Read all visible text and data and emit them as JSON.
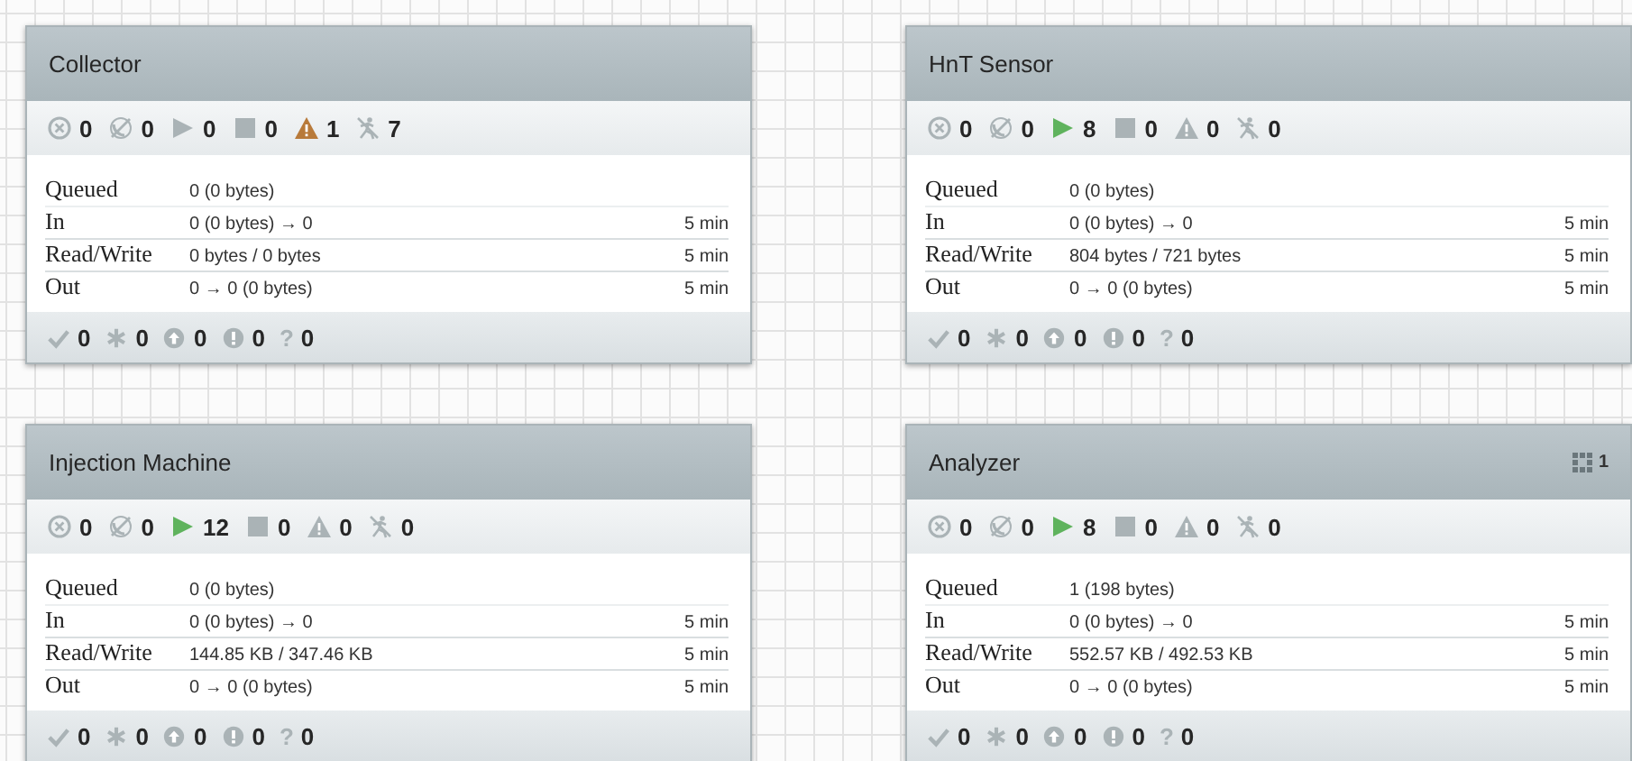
{
  "process_groups": [
    {
      "name": "Collector",
      "status": [
        {
          "kind": "transmitting",
          "count": "0",
          "highlighted": false
        },
        {
          "kind": "not_transmitting",
          "count": "0",
          "highlighted": false
        },
        {
          "kind": "running",
          "count": "0",
          "highlighted": false
        },
        {
          "kind": "stopped",
          "count": "0",
          "highlighted": false
        },
        {
          "kind": "invalid",
          "count": "1",
          "highlighted": true
        },
        {
          "kind": "disabled",
          "count": "7",
          "highlighted": false
        }
      ],
      "stats": [
        {
          "label": "Queued",
          "value": "0 (0 bytes)"
        },
        {
          "label": "In",
          "value": "0 (0 bytes) → 0",
          "window": "5 min"
        },
        {
          "label": "Read/Write",
          "value": "0 bytes / 0 bytes",
          "window": "5 min"
        },
        {
          "label": "Out",
          "value": "0 → 0 (0 bytes)",
          "window": "5 min"
        }
      ],
      "versions": [
        {
          "kind": "up_to_date",
          "count": "0"
        },
        {
          "kind": "locally_modified",
          "count": "0"
        },
        {
          "kind": "stale",
          "count": "0"
        },
        {
          "kind": "sync_failure",
          "count": "0"
        },
        {
          "kind": "unknown",
          "glyph": "?",
          "count": "0"
        }
      ]
    },
    {
      "name": "HnT Sensor",
      "status": [
        {
          "kind": "transmitting",
          "count": "0",
          "highlighted": false
        },
        {
          "kind": "not_transmitting",
          "count": "0",
          "highlighted": false
        },
        {
          "kind": "running",
          "count": "8",
          "highlighted": true
        },
        {
          "kind": "stopped",
          "count": "0",
          "highlighted": false
        },
        {
          "kind": "invalid",
          "count": "0",
          "highlighted": false
        },
        {
          "kind": "disabled",
          "count": "0",
          "highlighted": false
        }
      ],
      "stats": [
        {
          "label": "Queued",
          "value": "0 (0 bytes)"
        },
        {
          "label": "In",
          "value": "0 (0 bytes) → 0",
          "window": "5 min"
        },
        {
          "label": "Read/Write",
          "value": "804 bytes / 721 bytes",
          "window": "5 min"
        },
        {
          "label": "Out",
          "value": "0 → 0 (0 bytes)",
          "window": "5 min"
        }
      ],
      "versions": [
        {
          "kind": "up_to_date",
          "count": "0"
        },
        {
          "kind": "locally_modified",
          "count": "0"
        },
        {
          "kind": "stale",
          "count": "0"
        },
        {
          "kind": "sync_failure",
          "count": "0"
        },
        {
          "kind": "unknown",
          "glyph": "?",
          "count": "0"
        }
      ]
    },
    {
      "name": "Injection Machine",
      "status": [
        {
          "kind": "transmitting",
          "count": "0",
          "highlighted": false
        },
        {
          "kind": "not_transmitting",
          "count": "0",
          "highlighted": false
        },
        {
          "kind": "running",
          "count": "12",
          "highlighted": true
        },
        {
          "kind": "stopped",
          "count": "0",
          "highlighted": false
        },
        {
          "kind": "invalid",
          "count": "0",
          "highlighted": false
        },
        {
          "kind": "disabled",
          "count": "0",
          "highlighted": false
        }
      ],
      "stats": [
        {
          "label": "Queued",
          "value": "0 (0 bytes)"
        },
        {
          "label": "In",
          "value": "0 (0 bytes) → 0",
          "window": "5 min"
        },
        {
          "label": "Read/Write",
          "value": "144.85 KB / 347.46 KB",
          "window": "5 min"
        },
        {
          "label": "Out",
          "value": "0 → 0 (0 bytes)",
          "window": "5 min"
        }
      ],
      "versions": [
        {
          "kind": "up_to_date",
          "count": "0"
        },
        {
          "kind": "locally_modified",
          "count": "0"
        },
        {
          "kind": "stale",
          "count": "0"
        },
        {
          "kind": "sync_failure",
          "count": "0"
        },
        {
          "kind": "unknown",
          "glyph": "?",
          "count": "0"
        }
      ]
    },
    {
      "name": "Analyzer",
      "badge": {
        "count": "1"
      },
      "status": [
        {
          "kind": "transmitting",
          "count": "0",
          "highlighted": false
        },
        {
          "kind": "not_transmitting",
          "count": "0",
          "highlighted": false
        },
        {
          "kind": "running",
          "count": "8",
          "highlighted": true
        },
        {
          "kind": "stopped",
          "count": "0",
          "highlighted": false
        },
        {
          "kind": "invalid",
          "count": "0",
          "highlighted": false
        },
        {
          "kind": "disabled",
          "count": "0",
          "highlighted": false
        }
      ],
      "stats": [
        {
          "label": "Queued",
          "value": "1 (198 bytes)"
        },
        {
          "label": "In",
          "value": "0 (0 bytes) → 0",
          "window": "5 min"
        },
        {
          "label": "Read/Write",
          "value": "552.57 KB / 492.53 KB",
          "window": "5 min"
        },
        {
          "label": "Out",
          "value": "0 → 0 (0 bytes)",
          "window": "5 min"
        }
      ],
      "versions": [
        {
          "kind": "up_to_date",
          "count": "0"
        },
        {
          "kind": "locally_modified",
          "count": "0"
        },
        {
          "kind": "stale",
          "count": "0"
        },
        {
          "kind": "sync_failure",
          "count": "0"
        },
        {
          "kind": "unknown",
          "glyph": "?",
          "count": "0"
        }
      ]
    }
  ]
}
